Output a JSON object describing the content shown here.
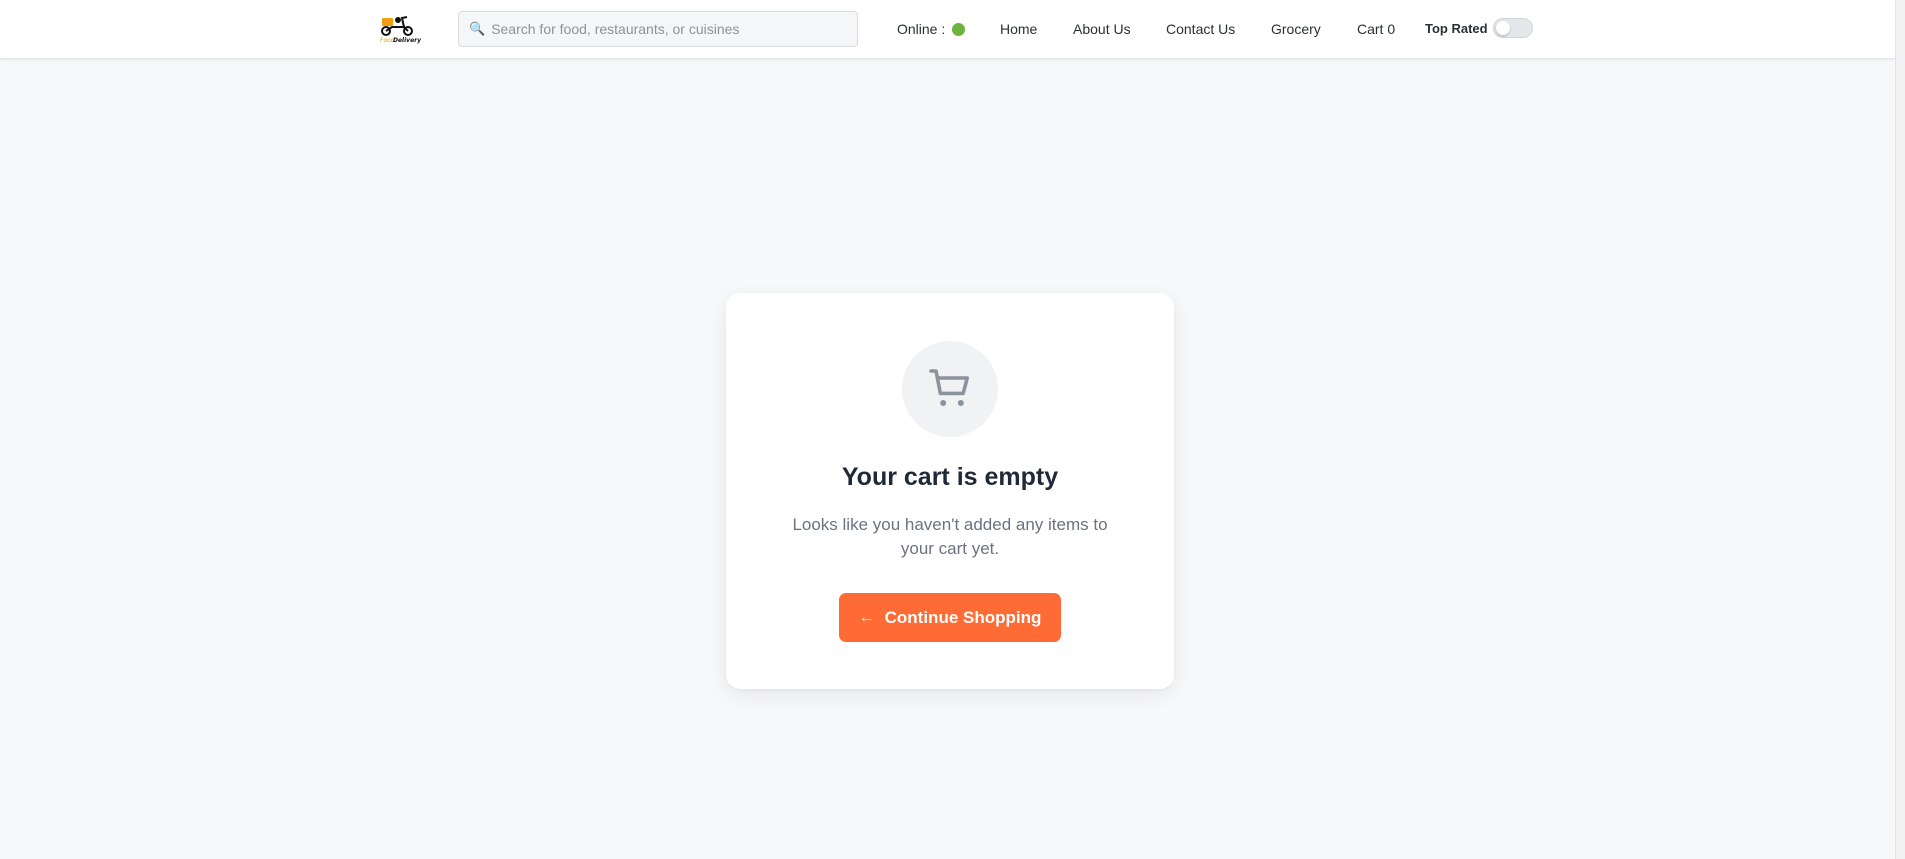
{
  "header": {
    "logo_alt": "FoodDelivery",
    "search": {
      "placeholder": "Search for food, restaurants, or cuisines",
      "value": ""
    },
    "nav": {
      "online_label": "Online :",
      "home": "Home",
      "about": "About Us",
      "contact": "Contact Us",
      "grocery": "Grocery",
      "cart": "Cart 0"
    },
    "top_rated_label": "Top Rated",
    "top_rated_on": false
  },
  "empty_cart": {
    "title": "Your cart is empty",
    "message": "Looks like you haven't added any items to your cart yet.",
    "button_label": "Continue Shopping",
    "button_icon": "arrow-left-icon",
    "illustration_icon": "shopping-cart-icon"
  },
  "colors": {
    "accent": "#ff6b35",
    "online": "#6cb33f",
    "background": "#f7f8fa"
  }
}
